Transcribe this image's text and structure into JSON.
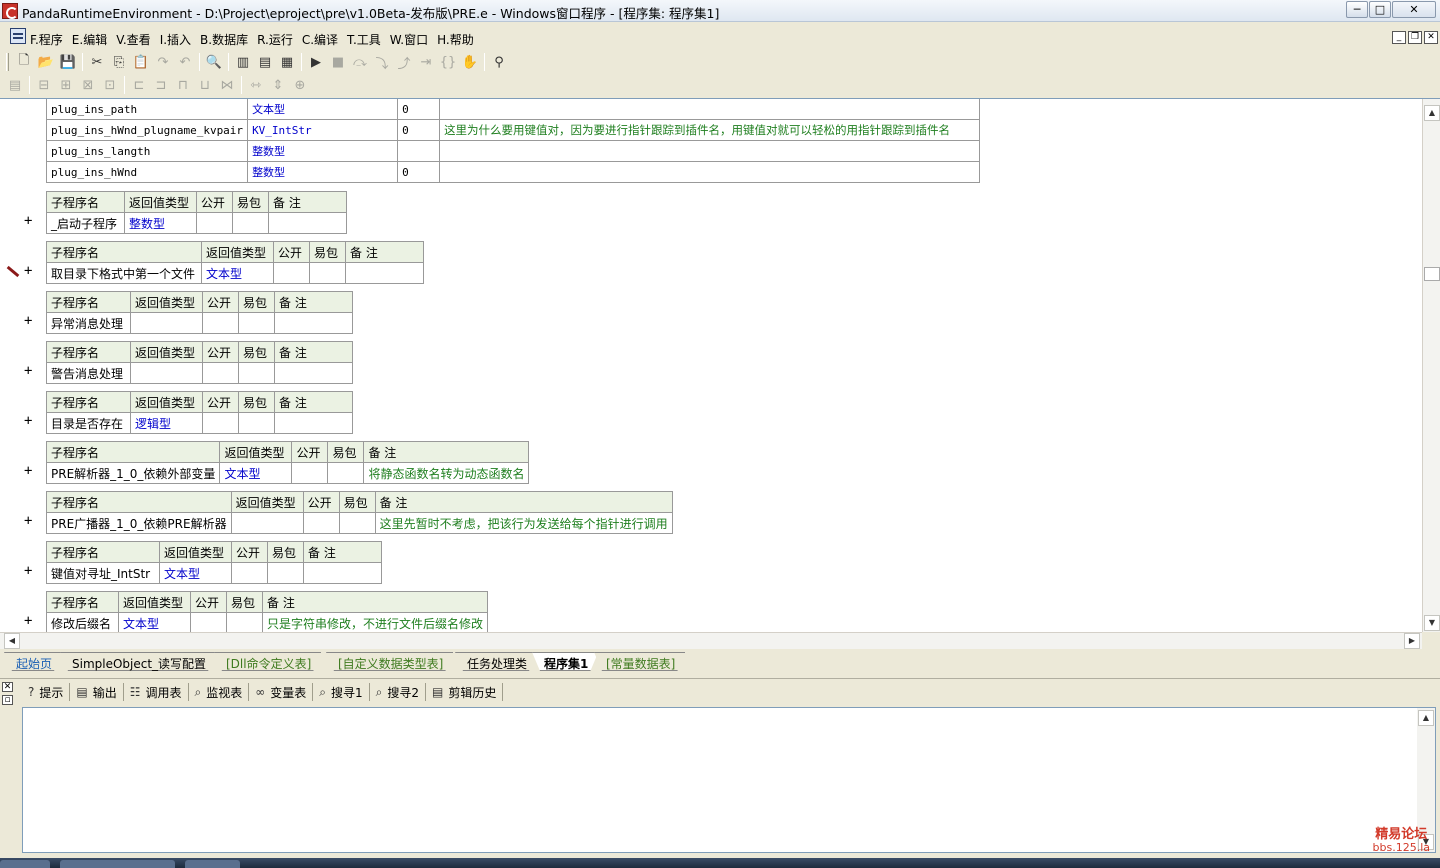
{
  "window": {
    "title": "PandaRuntimeEnvironment - D:\\Project\\eproject\\pre\\v1.0Beta-发布版\\PRE.e - Windows窗口程序 - [程序集: 程序集1]",
    "buttons": {
      "minimize": "─",
      "maximize": "□",
      "close": "✕"
    }
  },
  "menu": {
    "items": [
      "F.程序",
      "E.编辑",
      "V.查看",
      "I.插入",
      "B.数据库",
      "R.运行",
      "C.编译",
      "T.工具",
      "W.窗口",
      "H.帮助"
    ],
    "mdi_buttons": [
      "_",
      "❐",
      "✕"
    ]
  },
  "vars_table": {
    "rows": [
      {
        "name": "plug_ins_path",
        "type": "文本型",
        "array": "0",
        "note": ""
      },
      {
        "name": "plug_ins_hWnd_plugname_kvpair",
        "type": "KV_IntStr",
        "array": "0",
        "note": "这里为什么要用键值对，因为要进行指针跟踪到插件名，用键值对就可以轻松的用指针跟踪到插件名"
      },
      {
        "name": "plug_ins_langth",
        "type": "整数型",
        "array": "",
        "note": ""
      },
      {
        "name": "plug_ins_hWnd",
        "type": "整数型",
        "array": "0",
        "note": ""
      }
    ]
  },
  "sub_header": {
    "name": "子程序名",
    "ret": "返回值类型",
    "public": "公开",
    "easy": "易包",
    "note": "备 注"
  },
  "subs": [
    {
      "name": "_启动子程序",
      "ret": "整数型",
      "note": ""
    },
    {
      "name": "取目录下格式中第一个文件",
      "ret": "文本型",
      "note": ""
    },
    {
      "name": "异常消息处理",
      "ret": "",
      "note": ""
    },
    {
      "name": "警告消息处理",
      "ret": "",
      "note": ""
    },
    {
      "name": "目录是否存在",
      "ret": "逻辑型",
      "note": ""
    },
    {
      "name": "PRE解析器_1_0_依赖外部变量",
      "ret": "文本型",
      "note": "将静态函数名转为动态函数名"
    },
    {
      "name": "PRE广播器_1_0_依赖PRE解析器",
      "ret": "",
      "note": "这里先暂时不考虑，把该行为发送给每个指针进行调用"
    },
    {
      "name": "键值对寻址_IntStr",
      "ret": "文本型",
      "note": ""
    },
    {
      "name": "修改后缀名",
      "ret": "文本型",
      "note": "只是字符串修改，不进行文件后缀名修改"
    }
  ],
  "plus_sign": "+",
  "tabs": [
    "起始页",
    "SimpleObject_读写配置",
    "[Dll命令定义表]",
    "[自定义数据类型表]",
    "任务处理类",
    "程序集1",
    "[常量数据表]"
  ],
  "panel_tabs": [
    {
      "icon": "?",
      "label": "提示"
    },
    {
      "icon": "▤",
      "label": "输出"
    },
    {
      "icon": "☷",
      "label": "调用表"
    },
    {
      "icon": "⌕",
      "label": "监视表"
    },
    {
      "icon": "∞",
      "label": "变量表"
    },
    {
      "icon": "⌕",
      "label": "搜寻1"
    },
    {
      "icon": "⌕",
      "label": "搜寻2"
    },
    {
      "icon": "▤",
      "label": "剪辑历史"
    }
  ],
  "watermark": {
    "line1": "精易论坛",
    "line2": "bbs.125.la"
  },
  "colors": {
    "type_blue": "#0000cc",
    "comment_green": "#1f7f1f",
    "header_bg": "#ebf2e3"
  }
}
